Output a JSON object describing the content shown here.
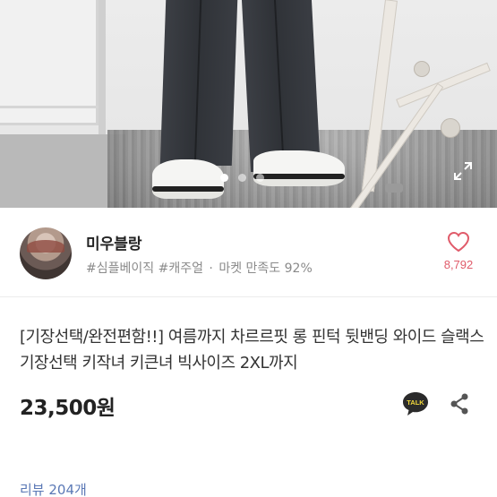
{
  "photo": {
    "slides": [
      true,
      false,
      false
    ],
    "expand_icon": "expand-icon"
  },
  "seller": {
    "name": "미우블랑",
    "tags": [
      "#심플베이직",
      "#캐주얼"
    ],
    "satisfaction_label": "마켓 만족도 92%",
    "separator": "·",
    "like_count": "8,792",
    "heart_color": "#e05b6a"
  },
  "product": {
    "title": "[기장선택/완전편함!!] 여름까지 차르르핏 롱 핀턱 뒷밴딩 와이드 슬랙스 기장선택 키작녀 키큰녀 빅사이즈 2XL까지",
    "price": "23,500원",
    "talk_label": "TALK",
    "talk_color": "#2b2b2b",
    "share_icon": "share-icon"
  },
  "review": {
    "label": "리뷰 204개"
  }
}
